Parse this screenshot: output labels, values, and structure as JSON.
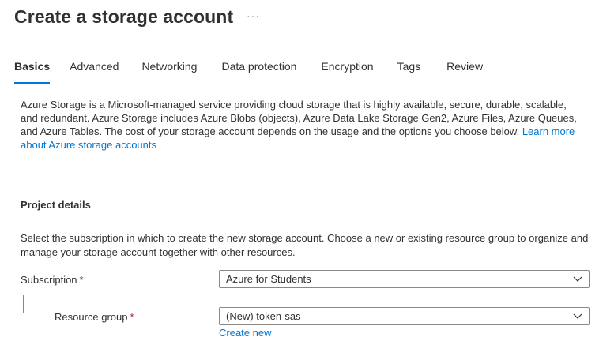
{
  "header": {
    "title": "Create a storage account",
    "more": "···"
  },
  "tabs": [
    {
      "label": "Basics",
      "active": true
    },
    {
      "label": "Advanced"
    },
    {
      "label": "Networking"
    },
    {
      "label": "Data protection"
    },
    {
      "label": "Encryption"
    },
    {
      "label": "Tags"
    },
    {
      "label": "Review"
    }
  ],
  "intro": {
    "text": "Azure Storage is a Microsoft-managed service providing cloud storage that is highly available, secure, durable, scalable, and redundant. Azure Storage includes Azure Blobs (objects), Azure Data Lake Storage Gen2, Azure Files, Azure Queues, and Azure Tables. The cost of your storage account depends on the usage and the options you choose below. ",
    "link": "Learn more about Azure storage accounts"
  },
  "project_details": {
    "heading": "Project details",
    "description": "Select the subscription in which to create the new storage account. Choose a new or existing resource group to organize and manage your storage account together with other resources.",
    "subscription": {
      "label": "Subscription",
      "required": "*",
      "value": "Azure for Students"
    },
    "resource_group": {
      "label": "Resource group",
      "required": "*",
      "value": "(New) token-sas",
      "create_new": "Create new"
    }
  },
  "colors": {
    "accent": "#0078d4",
    "required": "#a4262c",
    "text": "#323130",
    "border": "#8a8886"
  }
}
